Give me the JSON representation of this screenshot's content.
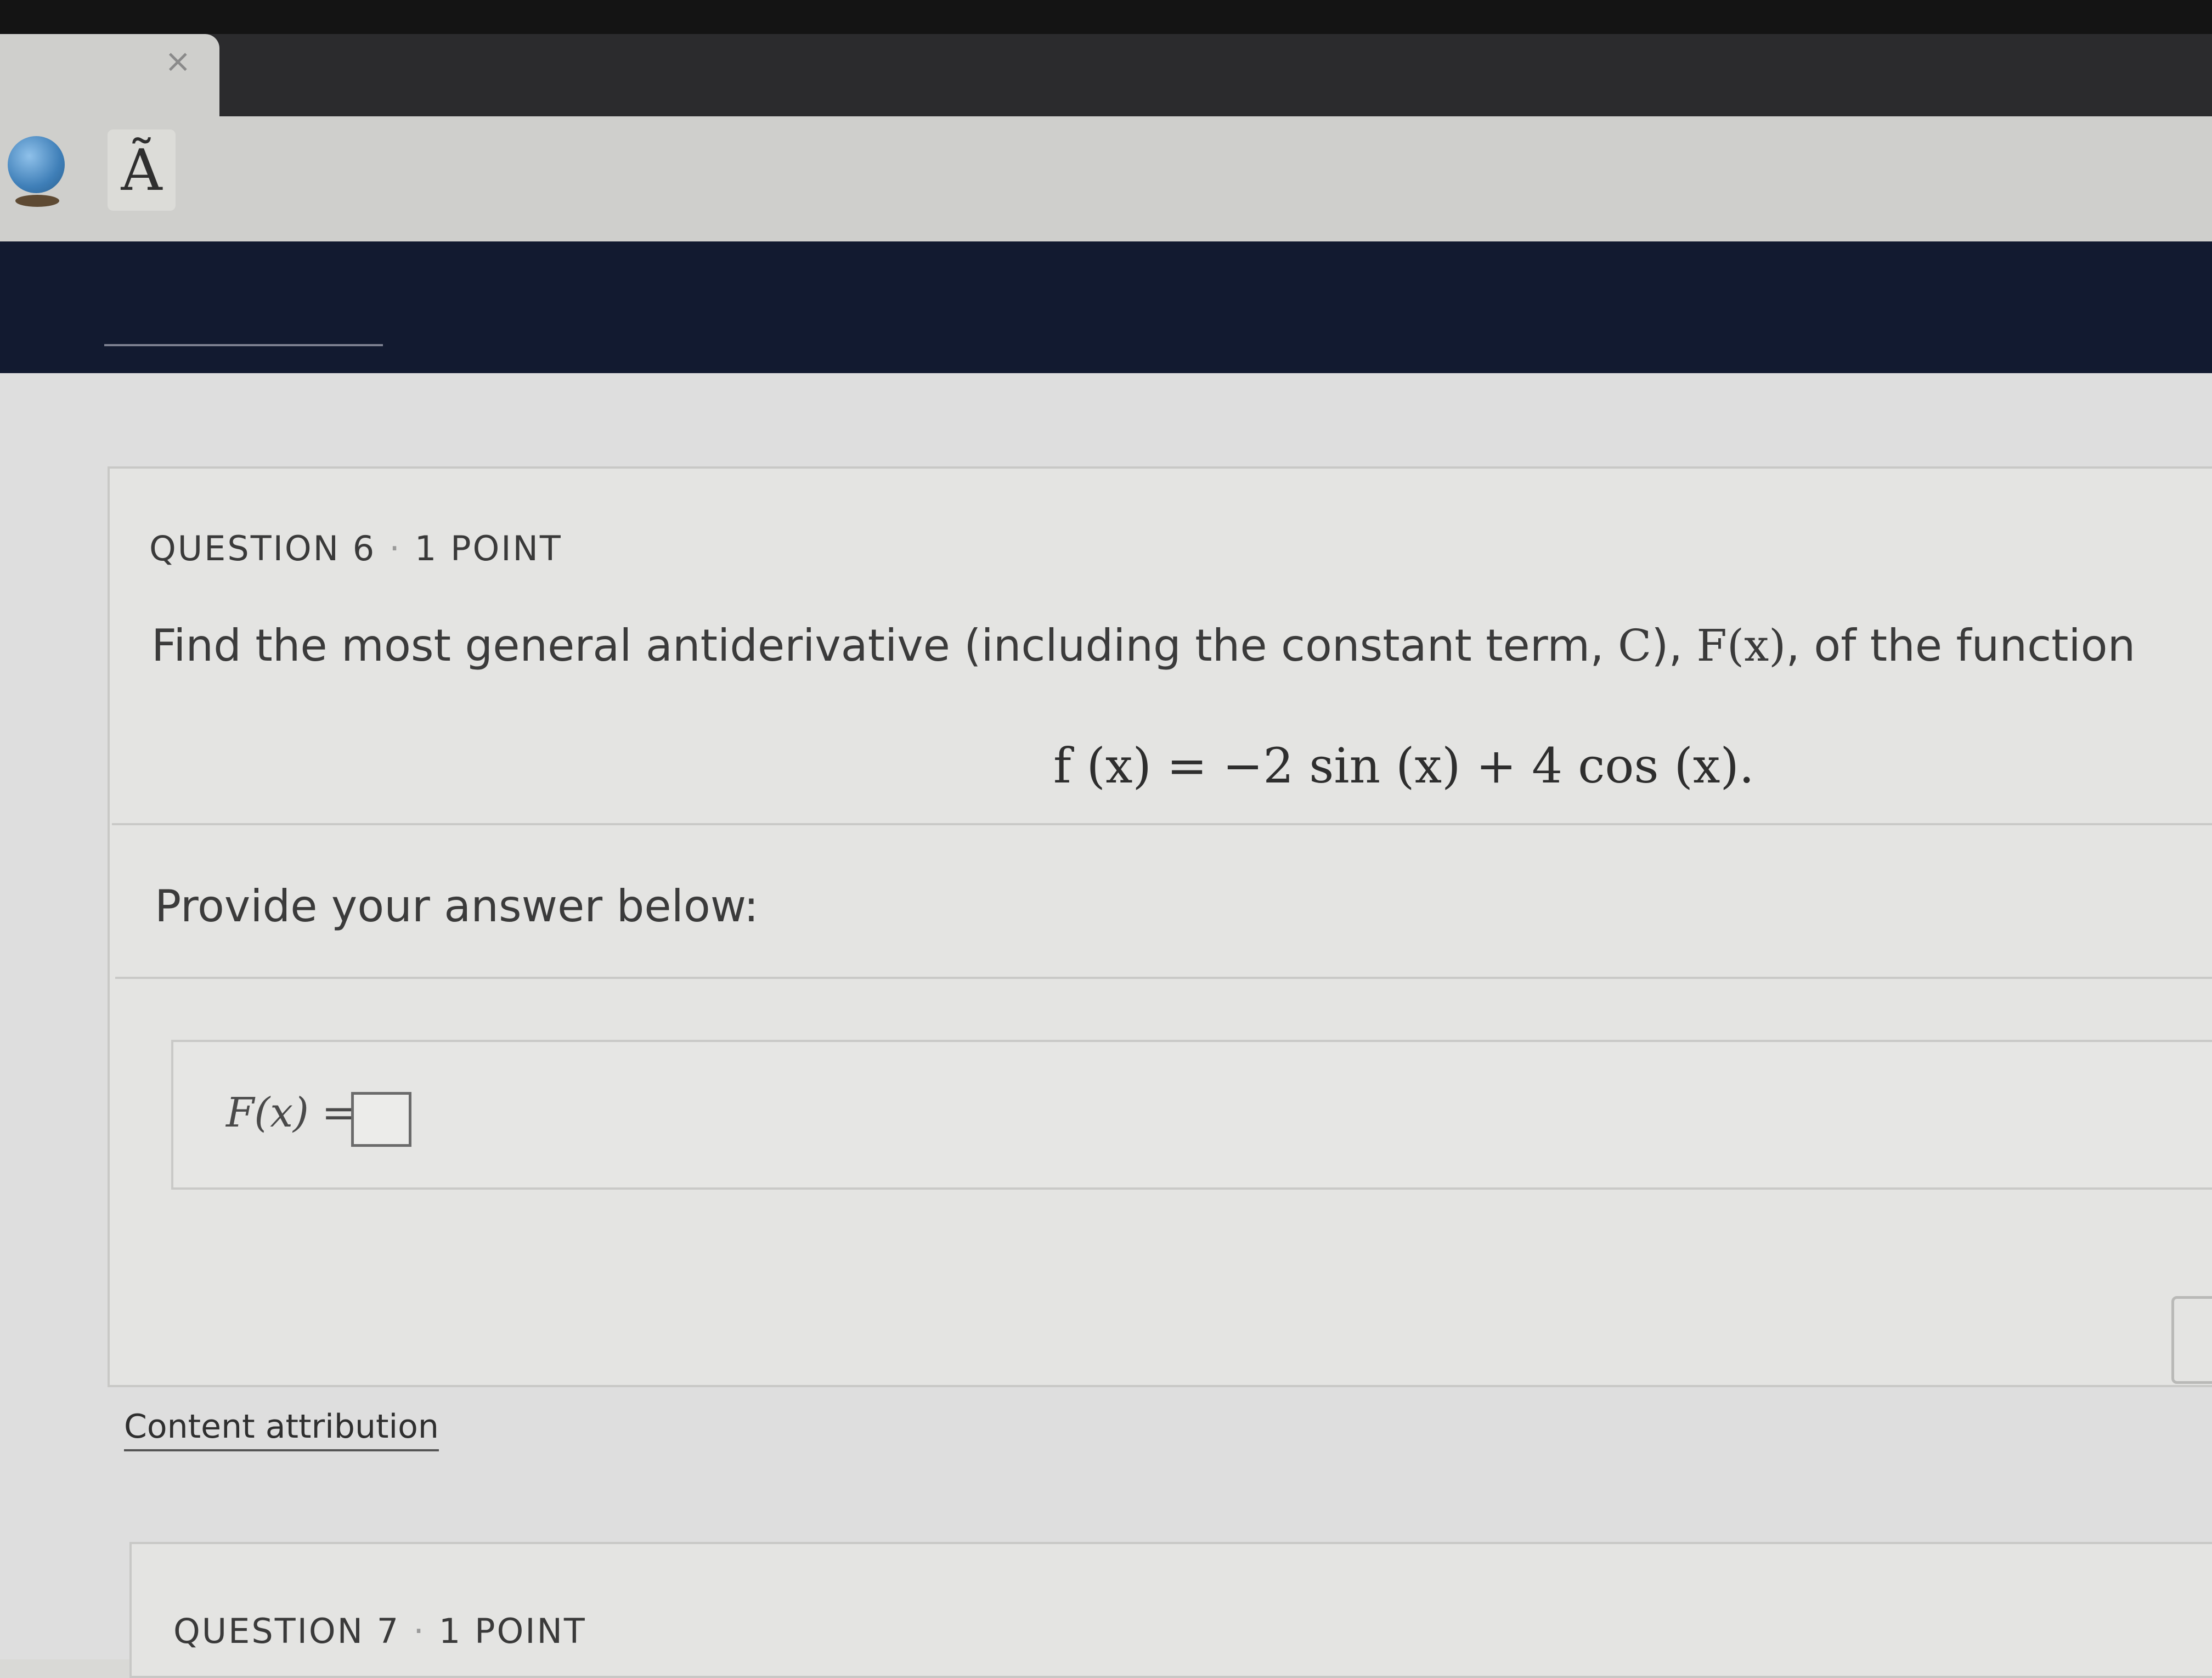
{
  "browser": {
    "tab_close_glyph": "×",
    "reader_glyph": "Ã"
  },
  "question6": {
    "number_label": "QUESTION 6",
    "separator": "·",
    "points_label": "1 POINT",
    "prompt_before": "Find the most general antiderivative (including the constant term, ",
    "prompt_c": "C",
    "prompt_mid": "), ",
    "prompt_fx": "F(x)",
    "prompt_after": ", of the function",
    "equation": "f (x) = −2 sin (x) + 4 cos (x).",
    "answer_label": "Provide your answer below:",
    "answer_lhs": "F(x) =",
    "answer_value": ""
  },
  "attribution": {
    "link_label": "Content attribution"
  },
  "question7": {
    "number_label": "QUESTION 7",
    "separator": "·",
    "points_label": "1 POINT"
  }
}
